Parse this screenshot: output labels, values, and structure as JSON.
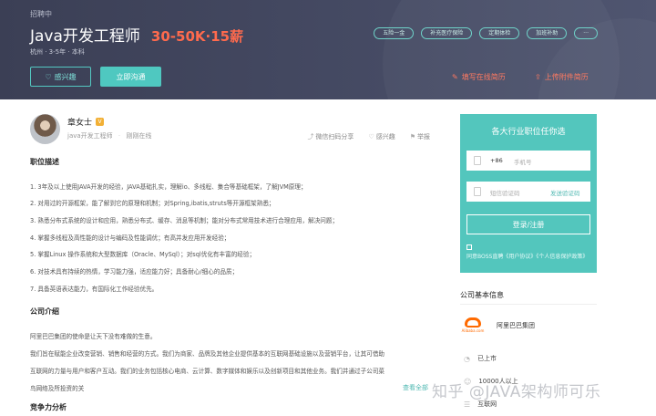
{
  "header": {
    "status": "招聘中",
    "job_title": "Java开发工程师",
    "salary": "30-50K·15薪",
    "meta": "杭州 · 3-5年 · 本科",
    "tags": [
      "五险一金",
      "补充医疗保险",
      "定期体检",
      "加班补助",
      "···"
    ],
    "interest_label": "感兴趣",
    "chat_label": "立即沟通",
    "fill_resume": "填写在线简历",
    "upload_resume": "上传附件简历"
  },
  "recruiter": {
    "name": "章女士",
    "badge": "V",
    "title": "java开发工程师",
    "active": "刚刚在线",
    "share": "微信扫码分享",
    "interest": "感兴趣",
    "report": "举报"
  },
  "job_description": {
    "heading": "职位描述",
    "lines": [
      "1. 3年及以上使用JAVA开发的经验，JAVA基础扎实，理解io、多线程、集合等基础框架，了解JVM原理；",
      "2. 对用过的开源框架，能了解到它的原理和机制；对Spring,ibatis,struts等开源框架熟悉；",
      "3. 熟悉分布式系统的设计和应用，熟悉分布式、缓存、消息等机制；能对分布式常用技术进行合理应用，解决问题；",
      "4. 掌握多线程及高性能的设计与编码及性能调优；有高并发应用开发经验；",
      "5. 掌握Linux 操作系统和大型数据库（Oracle、MySql）；对sql优化有丰富的经验；",
      "6. 对技术具有持续的热情，学习能力强，适应能力好；具备耐心/细心的品质；",
      "7. 具备英语表达能力，有国际化工作经验优先。"
    ]
  },
  "company_intro": {
    "heading": "公司介绍",
    "lines": [
      "阿里巴巴集团的使命是让天下没有难做的生意。",
      "我们旨在赋能企业改变营销、销售和经营的方式。我们为商家、品牌及其他企业提供基本的互联网基础设施以及营销平台，让其可借助",
      "互联网的力量与用户和客户互动。我们的业务包括核心电商、云计算、数字媒体和娱乐以及创新项目和其他业务。我们并通过子公司菜",
      "鸟网络及所投资的关"
    ],
    "more": "查看全部"
  },
  "competition": {
    "heading": "竞争力分析"
  },
  "login_panel": {
    "title": "各大行业职位任你选",
    "country_code": "+86",
    "phone_placeholder": "手机号",
    "sms_placeholder": "短信验证码",
    "send_code": "发送验证码",
    "submit_label": "登录/注册",
    "agreement": "同意BOSS直聘《用户协议》《个人信息保护政策》"
  },
  "company": {
    "heading": "公司基本信息",
    "logo_text": "Alibaba.com",
    "name": "阿里巴巴集团",
    "stage": "已上市",
    "size": "10000人以上",
    "industry": "互联网"
  },
  "watermark": "知乎 @JAVA架构师可乐"
}
